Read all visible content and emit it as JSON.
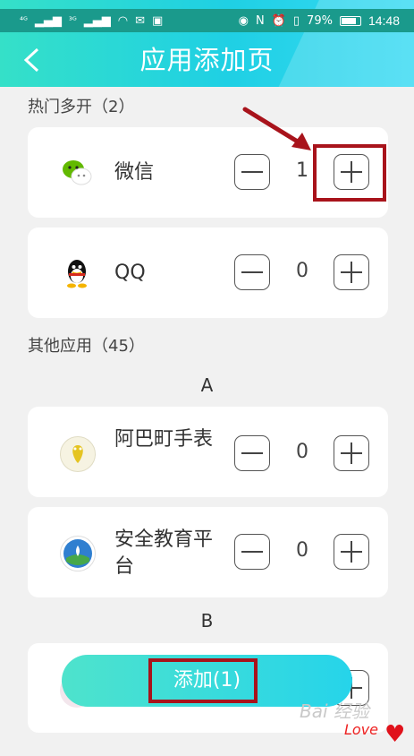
{
  "status_bar": {
    "signal1": "⁴ᴳ",
    "signal2": "³ᴳ",
    "battery_percent": "79%",
    "time": "14:48"
  },
  "header": {
    "title": "应用添加页",
    "back_glyph": "<"
  },
  "hot_section": {
    "label": "热门多开（2）",
    "items": [
      {
        "name": "微信",
        "count": "1",
        "icon": "wechat-icon"
      },
      {
        "name": "QQ",
        "count": "0",
        "icon": "qq-icon"
      }
    ]
  },
  "other_section": {
    "label": "其他应用（45）",
    "groups": [
      {
        "letter": "A",
        "items": [
          {
            "name": "阿巴町手表",
            "count": "0",
            "icon": "abading-icon"
          },
          {
            "name": "安全教育平台",
            "count": "0",
            "icon": "safety-edu-icon"
          }
        ]
      },
      {
        "letter": "B",
        "items": []
      }
    ]
  },
  "footer": {
    "add_label": "添加(1)"
  },
  "watermark": {
    "text": "Bai 经验",
    "love": "Love"
  },
  "colors": {
    "accent": "#26d4ea",
    "highlight": "#a8131b",
    "status_bg": "#1a9a8c"
  }
}
